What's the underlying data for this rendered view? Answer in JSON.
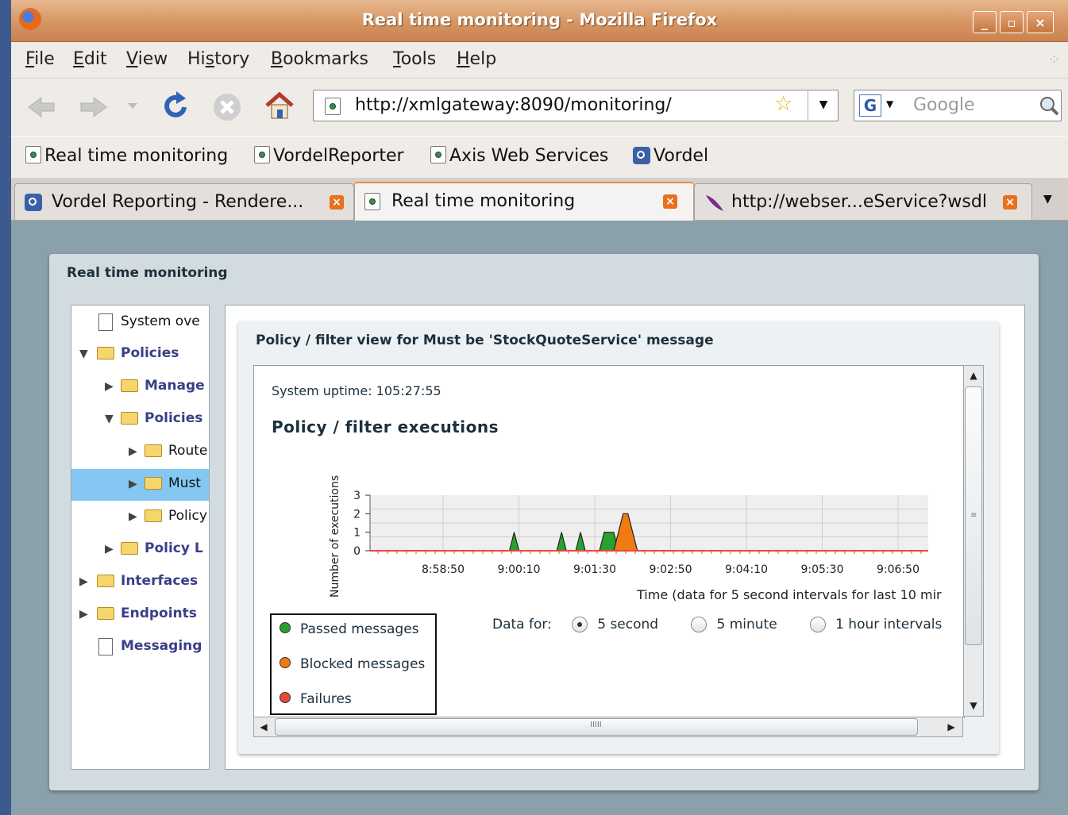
{
  "window": {
    "title": "Real time monitoring - Mozilla Firefox",
    "btn_min": "_",
    "btn_max": "▫",
    "btn_close": "×"
  },
  "menu": [
    "File",
    "Edit",
    "View",
    "History",
    "Bookmarks",
    "Tools",
    "Help"
  ],
  "nav": {
    "url": "http://xmlgateway:8090/monitoring/",
    "search_placeholder": "Google"
  },
  "bookmarks": [
    "Real time monitoring",
    "VordelReporter",
    "Axis Web Services",
    "Vordel"
  ],
  "tabs": [
    {
      "label": "Vordel Reporting - Rendere..."
    },
    {
      "label": "Real time monitoring"
    },
    {
      "label": "http://webser...eService?wsdl"
    }
  ],
  "page": {
    "panel_title": "Real time monitoring",
    "tree": [
      {
        "label": "System ove",
        "type": "doc"
      },
      {
        "label": "Policies",
        "type": "folder"
      },
      {
        "label": "Manage",
        "type": "folder"
      },
      {
        "label": "Policies",
        "type": "folder"
      },
      {
        "label": "Route",
        "type": "folder"
      },
      {
        "label": "Must",
        "type": "folder"
      },
      {
        "label": "Policy",
        "type": "folder"
      },
      {
        "label": "Policy L",
        "type": "folder"
      },
      {
        "label": "Interfaces",
        "type": "folder"
      },
      {
        "label": "Endpoints",
        "type": "folder"
      },
      {
        "label": "Messaging",
        "type": "doc"
      }
    ],
    "card_title": "Policy / filter view for Must be 'StockQuoteService' message",
    "uptime": "System uptime: 105:27:55",
    "chart_title": "Policy / filter executions",
    "legend": [
      "Passed messages",
      "Blocked messages",
      "Failures"
    ],
    "data_for": {
      "label": "Data for:",
      "options": [
        "5 second",
        "5 minute",
        "1 hour  intervals"
      ],
      "selected": "5 second"
    },
    "hscroll_grip": "IIIII"
  },
  "colors": {
    "passed": "#2aa12f",
    "blocked": "#f07b12",
    "failures": "#e8473b"
  },
  "chart_data": {
    "type": "area",
    "ylabel": "Number of executions",
    "xlabel": "Time (data for 5 second intervals for last 10 mir",
    "ylim": [
      0,
      3
    ],
    "y_ticks": [
      "0",
      "1",
      "2",
      "3"
    ],
    "x_ticks": [
      "8:58:50",
      "9:00:10",
      "9:01:30",
      "9:02:50",
      "9:04:10",
      "9:05:30",
      "9:06:50"
    ],
    "grid": true,
    "series": [
      {
        "name": "Passed messages",
        "points": [
          [
            "9:00:00",
            0
          ],
          [
            "9:00:05",
            1
          ],
          [
            "9:00:10",
            0
          ],
          [
            "9:00:50",
            0
          ],
          [
            "9:00:55",
            1
          ],
          [
            "9:01:00",
            0
          ],
          [
            "9:01:10",
            0
          ],
          [
            "9:01:15",
            1
          ],
          [
            "9:01:20",
            0
          ],
          [
            "9:01:35",
            0
          ],
          [
            "9:01:40",
            1
          ],
          [
            "9:01:45",
            1
          ],
          [
            "9:01:50",
            1
          ],
          [
            "9:01:55",
            0
          ]
        ]
      },
      {
        "name": "Blocked messages",
        "points": [
          [
            "9:01:50",
            0
          ],
          [
            "9:01:55",
            1
          ],
          [
            "9:02:00",
            2
          ],
          [
            "9:02:05",
            2
          ],
          [
            "9:02:10",
            1
          ],
          [
            "9:02:15",
            0
          ]
        ]
      },
      {
        "name": "Failures",
        "points": [
          [
            "8:57:50",
            0
          ],
          [
            "9:07:50",
            0
          ]
        ]
      }
    ]
  }
}
